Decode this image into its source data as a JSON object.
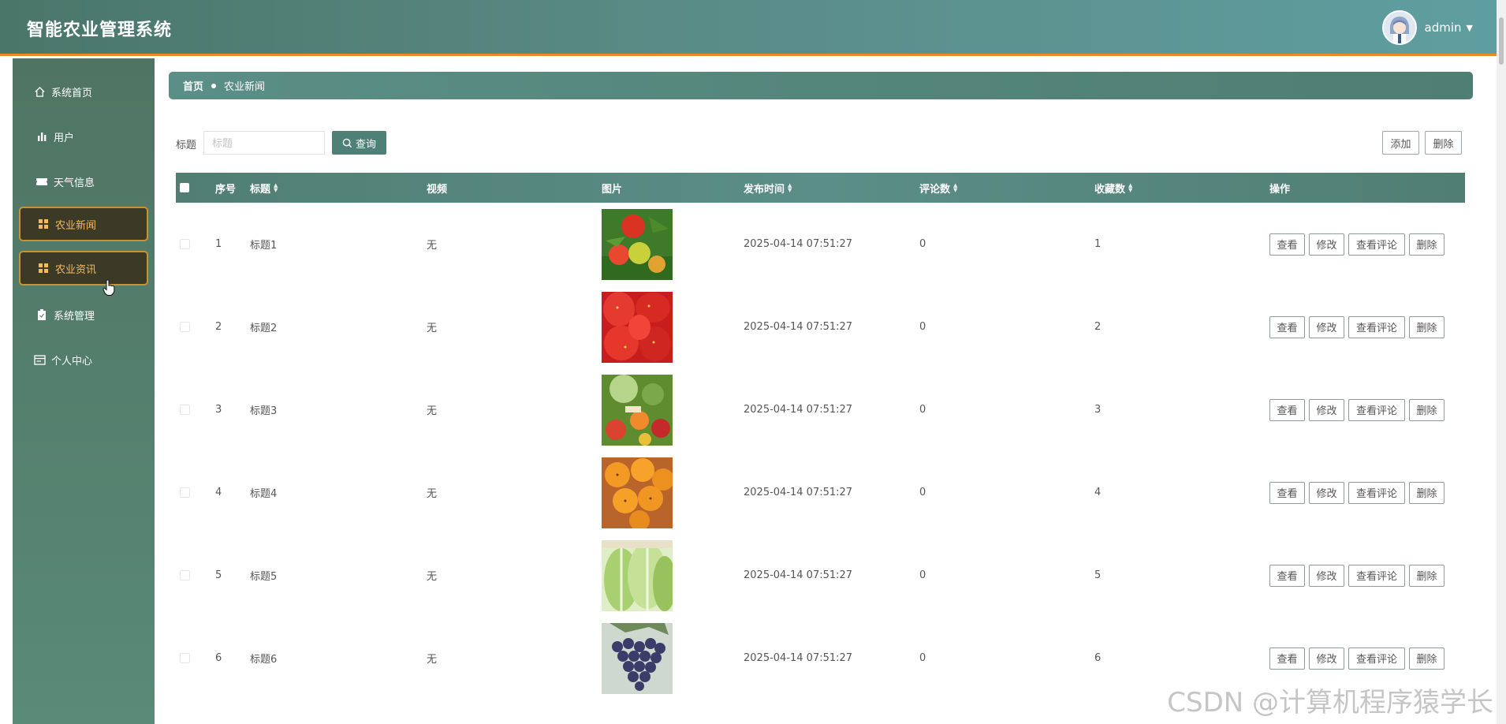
{
  "app": {
    "title": "智能农业管理系统"
  },
  "user": {
    "name": "admin"
  },
  "sidebar": {
    "items": [
      {
        "label": "系统首页",
        "icon": "home-icon"
      },
      {
        "label": "用户",
        "icon": "bar-chart-icon"
      },
      {
        "label": "天气信息",
        "icon": "ticket-icon"
      },
      {
        "label": "农业新闻",
        "icon": "grid-icon",
        "active": true
      },
      {
        "label": "农业资讯",
        "icon": "grid-icon",
        "active": true
      },
      {
        "label": "系统管理",
        "icon": "clipboard-icon"
      },
      {
        "label": "个人中心",
        "icon": "id-card-icon"
      }
    ]
  },
  "breadcrumb": {
    "home": "首页",
    "current": "农业新闻"
  },
  "search": {
    "label": "标题",
    "placeholder": "标题",
    "button": "查询"
  },
  "toolbar": {
    "add": "添加",
    "delete": "删除"
  },
  "table": {
    "columns": [
      "序号",
      "标题",
      "视频",
      "图片",
      "发布时间",
      "评论数",
      "收藏数",
      "操作"
    ],
    "rows": [
      {
        "index": "1",
        "title": "标题1",
        "video": "无",
        "image": "tomato",
        "published": "2025-04-14 07:51:27",
        "comments": "0",
        "favorites": "1"
      },
      {
        "index": "2",
        "title": "标题2",
        "video": "无",
        "image": "strawberry",
        "published": "2025-04-14 07:51:27",
        "comments": "0",
        "favorites": "2"
      },
      {
        "index": "3",
        "title": "标题3",
        "video": "无",
        "image": "vegetables",
        "published": "2025-04-14 07:51:27",
        "comments": "0",
        "favorites": "3"
      },
      {
        "index": "4",
        "title": "标题4",
        "video": "无",
        "image": "loquat",
        "published": "2025-04-14 07:51:27",
        "comments": "0",
        "favorites": "4"
      },
      {
        "index": "5",
        "title": "标题5",
        "video": "无",
        "image": "cabbage",
        "published": "2025-04-14 07:51:27",
        "comments": "0",
        "favorites": "5"
      },
      {
        "index": "6",
        "title": "标题6",
        "video": "无",
        "image": "grapes",
        "published": "2025-04-14 07:51:27",
        "comments": "0",
        "favorites": "6"
      }
    ],
    "actions": {
      "view": "查看",
      "edit": "修改",
      "view_comments": "查看评论",
      "delete": "删除"
    }
  },
  "watermark": "CSDN @计算机程序猿学长",
  "colors": {
    "header": "#5a8b86",
    "sidebar": "#4f7463",
    "accent": "#e8892a",
    "active_menu": "#3b3a27",
    "active_text": "#f7b95a"
  }
}
